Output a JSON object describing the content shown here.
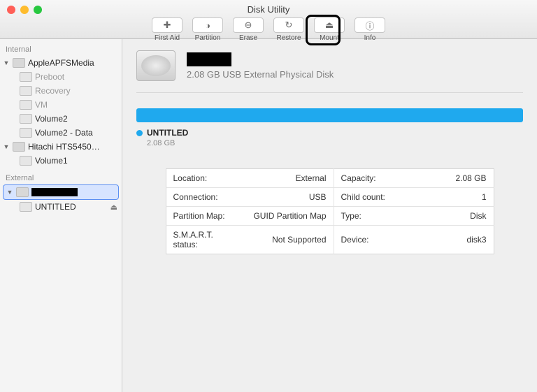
{
  "title": "Disk Utility",
  "toolbar": [
    {
      "label": "First Aid",
      "glyph": "✚"
    },
    {
      "label": "Partition",
      "glyph": "◑"
    },
    {
      "label": "Erase",
      "glyph": "⊖"
    },
    {
      "label": "Restore",
      "glyph": "↻"
    },
    {
      "label": "Mount",
      "glyph": "⏏"
    },
    {
      "label": "Info",
      "glyph": "ⓘ"
    }
  ],
  "sidebar": {
    "internal": {
      "header": "Internal",
      "items": [
        {
          "label": "AppleAPFSMedia",
          "expandable": true,
          "children": [
            {
              "label": "Preboot",
              "dim": true
            },
            {
              "label": "Recovery",
              "dim": true
            },
            {
              "label": "VM",
              "dim": true
            },
            {
              "label": "Volume2"
            },
            {
              "label": "Volume2 - Data"
            }
          ]
        },
        {
          "label": "Hitachi HTS5450…",
          "expandable": true,
          "children": [
            {
              "label": "Volume1"
            }
          ]
        }
      ]
    },
    "external": {
      "header": "External",
      "items": [
        {
          "label": "",
          "redacted": true,
          "selected": true
        },
        {
          "label": "UNTITLED",
          "eject": true
        }
      ]
    }
  },
  "detail": {
    "subtitle": "2.08 GB USB External Physical Disk",
    "bar_name": "UNTITLED",
    "bar_size": "2.08 GB",
    "rows": [
      {
        "k1": "Location:",
        "v1": "External",
        "k2": "Capacity:",
        "v2": "2.08 GB"
      },
      {
        "k1": "Connection:",
        "v1": "USB",
        "k2": "Child count:",
        "v2": "1"
      },
      {
        "k1": "Partition Map:",
        "v1": "GUID Partition Map",
        "k2": "Type:",
        "v2": "Disk"
      },
      {
        "k1": "S.M.A.R.T. status:",
        "v1": "Not Supported",
        "k2": "Device:",
        "v2": "disk3"
      }
    ]
  }
}
